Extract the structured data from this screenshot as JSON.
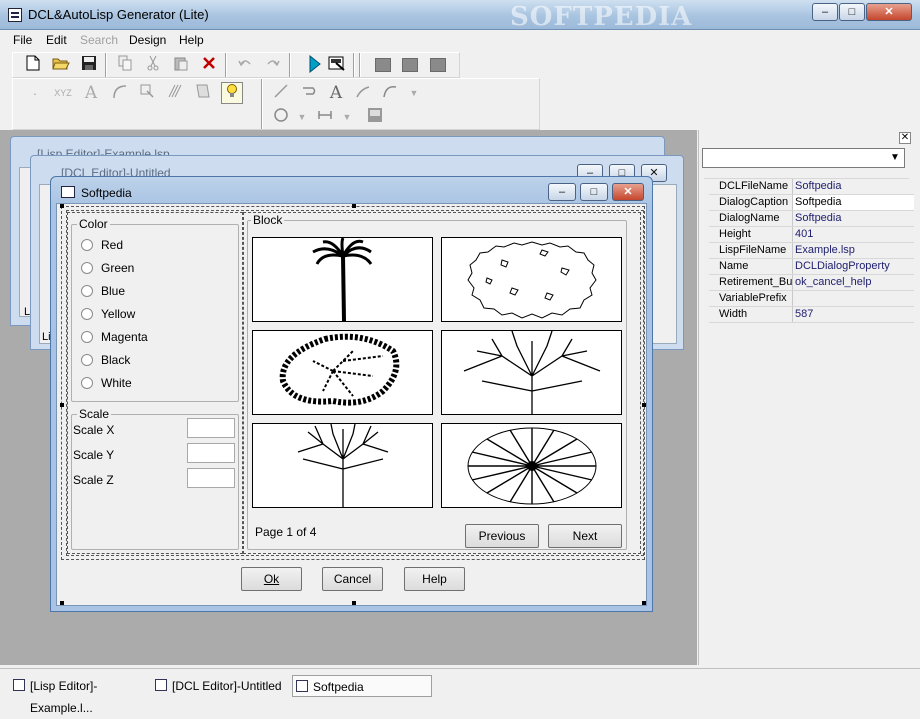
{
  "window": {
    "title": "DCL&AutoLisp Generator (Lite)",
    "watermark": "SOFTPEDIA",
    "controls": {
      "minimize": "–",
      "maximize": "□",
      "close": "✕"
    }
  },
  "menu": [
    {
      "label": "File",
      "disabled": false
    },
    {
      "label": "Edit",
      "disabled": false
    },
    {
      "label": "Search",
      "disabled": true
    },
    {
      "label": "Design",
      "disabled": false
    },
    {
      "label": "Help",
      "disabled": false
    }
  ],
  "toolbar1": {
    "icons": [
      "new-file-icon",
      "open-folder-icon",
      "save-icon",
      "copy-icon",
      "cut-icon",
      "paste-icon",
      "delete-icon",
      "undo-icon",
      "redo-icon",
      "run-icon",
      "preview-icon",
      "block-icon-1",
      "block-icon-2",
      "block-icon-3"
    ]
  },
  "toolbar2": {
    "icons": [
      "dot-tool-icon",
      "text-tool-icon",
      "font-tool-icon",
      "arc-tool-icon",
      "measure-tool-icon",
      "hatch-tool-icon",
      "style-tool-icon",
      "light-bulb-icon",
      "line-tool-icon",
      "path-tool-icon",
      "text-a-icon",
      "text-a-small-icon",
      "curve-tool-icon",
      "circle-tool-icon",
      "dimension-tool-icon",
      "image-tool-icon"
    ]
  },
  "mdi": {
    "lisp_editor_title": "[Lisp Editor]-Example.lsp",
    "dcl_editor_title": "[DCL Editor]-Untitled",
    "lisp_tab": "Lis",
    "dcl_tab": "Lis"
  },
  "dialog": {
    "title": "Softpedia",
    "color_group": {
      "label": "Color",
      "options": [
        "Red",
        "Green",
        "Blue",
        "Yellow",
        "Magenta",
        "Black",
        "White"
      ]
    },
    "scale_group": {
      "label": "Scale",
      "fields": [
        {
          "label": "Scale X",
          "value": ""
        },
        {
          "label": "Scale Y",
          "value": ""
        },
        {
          "label": "Scale Z",
          "value": ""
        }
      ]
    },
    "block_group": {
      "label": "Block",
      "tiles": [
        "palm-tree-icon",
        "round-shrub-outline-icon",
        "leafy-tree-scatter-icon",
        "bare-tree-wide-icon",
        "bare-tree-tall-icon",
        "radial-tree-plan-icon"
      ],
      "page_text": "Page 1 of 4",
      "previous": "Previous",
      "next": "Next"
    },
    "buttons": {
      "ok": "Ok",
      "cancel": "Cancel",
      "help": "Help"
    }
  },
  "properties": {
    "rows": [
      {
        "name": "DCLFileName",
        "value": "Softpedia"
      },
      {
        "name": "DialogCaption",
        "value": "Softpedia"
      },
      {
        "name": "DialogName",
        "value": "Softpedia"
      },
      {
        "name": "Height",
        "value": "401"
      },
      {
        "name": "LispFileName",
        "value": "Example.lsp"
      },
      {
        "name": "Name",
        "value": "DCLDialogProperty"
      },
      {
        "name": "Retirement_Bu",
        "value": "ok_cancel_help"
      },
      {
        "name": "VariablePrefix",
        "value": ""
      },
      {
        "name": "Width",
        "value": "587"
      }
    ]
  },
  "taskbar": [
    {
      "label": "[Lisp Editor]-Example.l...",
      "active": false
    },
    {
      "label": "[DCL Editor]-Untitled",
      "active": false
    },
    {
      "label": "Softpedia",
      "active": true
    }
  ]
}
